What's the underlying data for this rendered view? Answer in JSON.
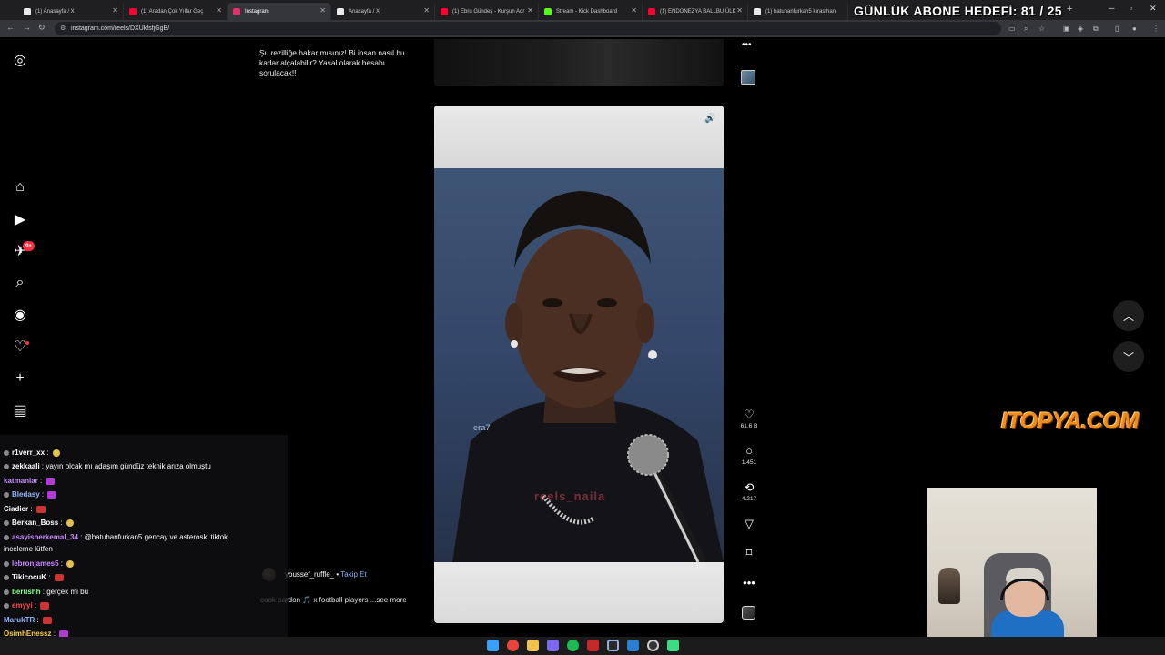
{
  "overlay": {
    "goal_text": "GÜNLÜK ABONE HEDEFİ: 81 / 25"
  },
  "browser": {
    "tabs": [
      {
        "label": "(1) Anasayfa / X",
        "color": "#e7e9ea"
      },
      {
        "label": "(1) Aradan Çok Yıllar Geç",
        "color": "#ff0033"
      },
      {
        "label": "Instagram",
        "color": "#e1306c"
      },
      {
        "label": "Anasayfa / X",
        "color": "#e7e9ea"
      },
      {
        "label": "(1) Ebru Gündeş - Kurşun Adr",
        "color": "#ff0033"
      },
      {
        "label": "Stream - Kick Dashboard",
        "color": "#53fc18"
      },
      {
        "label": "(1) ENDONEZYA BALLBU ÜLK",
        "color": "#ff0033"
      },
      {
        "label": "(1) batuhanfurkan5 kırasthan",
        "color": "#e7e9ea"
      }
    ],
    "url": "instagram.com/reels/DXUkfsfjGgB/"
  },
  "instagram": {
    "nav": [
      {
        "name": "instagram-logo-icon",
        "glyph": "◎"
      },
      {
        "name": "home-icon",
        "glyph": "⌂"
      },
      {
        "name": "reels-icon",
        "glyph": "▶"
      },
      {
        "name": "send-icon",
        "glyph": "✈"
      },
      {
        "name": "search-icon",
        "glyph": "⌕"
      },
      {
        "name": "explore-icon",
        "glyph": "◉"
      },
      {
        "name": "notifications-heart-icon",
        "glyph": "♡"
      },
      {
        "name": "create-icon",
        "glyph": "+"
      },
      {
        "name": "dashboard-icon",
        "glyph": "▤"
      }
    ],
    "notif_badge": "9+",
    "prev_caption": "Şu rezilliğe bakar mısınız! Bi insan nasıl bu kadar alçalabilir? Yasal olarak hesabı sorulacak!!",
    "reel": {
      "watermark1": "era7",
      "watermark2": "reels_naila",
      "likes": "61,6 B",
      "comments": "1.451",
      "reposts": "4.217",
      "author": "youssef_ruffle_",
      "follow": "Takip Et",
      "caption": "cook pardon 🎵 x football players ...see more"
    }
  },
  "logo_text": "ITOPYA.COM",
  "chat": [
    {
      "user": "r1verr_xx",
      "text": "",
      "color": "#ffffff",
      "emote": "y"
    },
    {
      "user": "zekkaali",
      "text": "yayın olcak mı adaşım gündüz teknik arıza olmuştu",
      "color": "#ffffff",
      "emote": ""
    },
    {
      "user": "katmanlar",
      "text": "",
      "color": "#c98cff",
      "emote": "p"
    },
    {
      "user": "Bledasy",
      "text": "",
      "color": "#8fb8ff",
      "emote": "p"
    },
    {
      "user": "Ciadier",
      "text": "",
      "color": "#ffffff",
      "emote": "r"
    },
    {
      "user": "Berkan_Boss",
      "text": "",
      "color": "#ffffff",
      "emote": "y"
    },
    {
      "user": "asayisberkemal_34",
      "text": "@batuhanfurkan5 gencay ve asteroski tiktok",
      "color": "#c98cff",
      "emote": ""
    },
    {
      "user": "",
      "text": "inceleme lütfen",
      "color": "#ffffff",
      "emote": ""
    },
    {
      "user": "lebronjames5",
      "text": "",
      "color": "#c98cff",
      "emote": "y"
    },
    {
      "user": "TikicocuK",
      "text": "",
      "color": "#ffffff",
      "emote": "r"
    },
    {
      "user": "berushh",
      "text": "gerçek mi bu",
      "color": "#8fff8f",
      "emote": ""
    },
    {
      "user": "emyyi",
      "text": "",
      "color": "#ff4d4d",
      "emote": "r"
    },
    {
      "user": "MarukTR",
      "text": "",
      "color": "#8fb8ff",
      "emote": "r"
    },
    {
      "user": "OsimhEnessz",
      "text": "",
      "color": "#ffd34d",
      "emote": "p"
    }
  ]
}
